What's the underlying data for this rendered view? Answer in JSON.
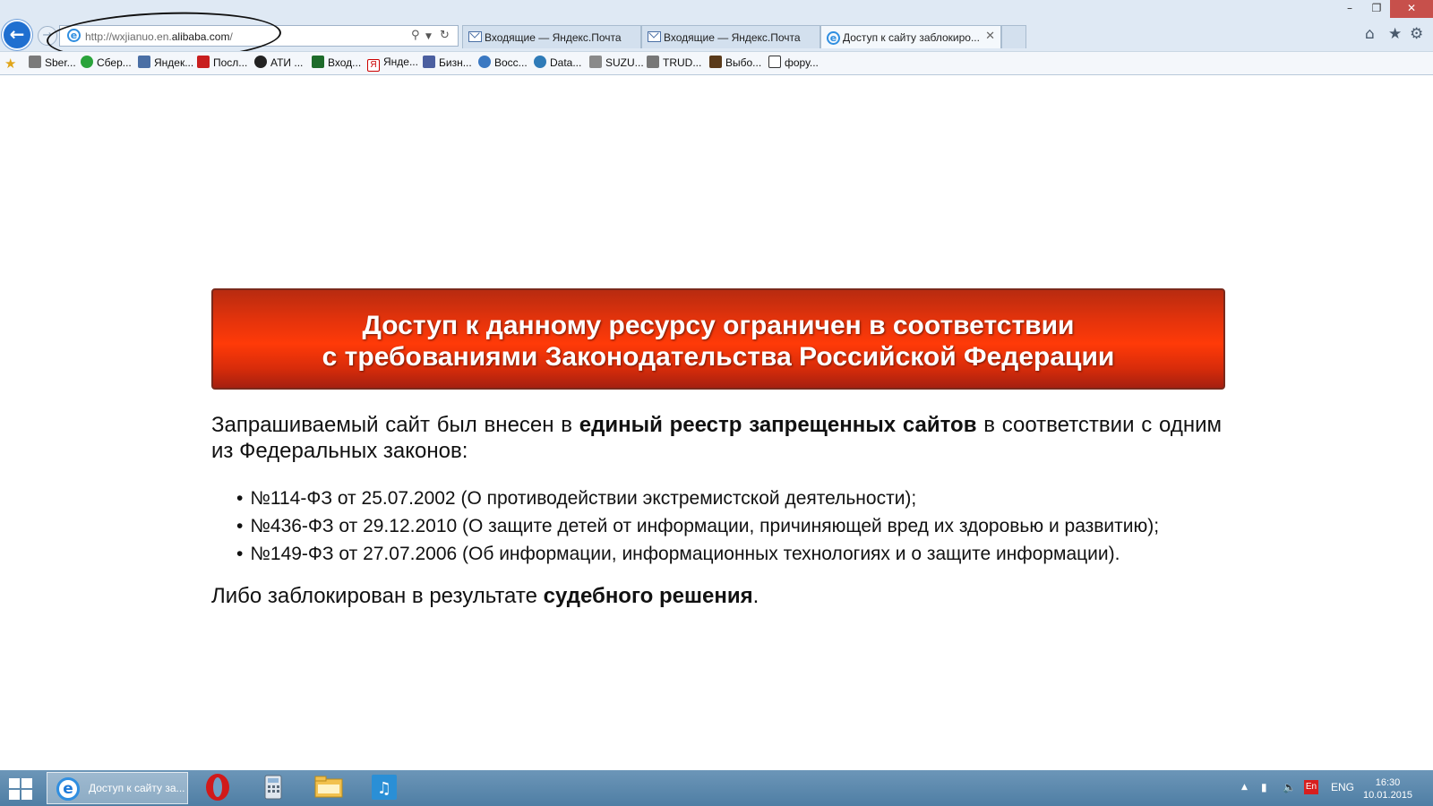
{
  "browser": {
    "address_url_prefix": "http://wxjianuo.en.",
    "address_url_domain": "alibaba.com",
    "address_url_suffix": "/",
    "tabs": [
      {
        "label": "Входящие — Яндекс.Почта",
        "active": false,
        "icon": "mail-icon"
      },
      {
        "label": "Входящие — Яндекс.Почта",
        "active": false,
        "icon": "mail-icon"
      },
      {
        "label": "Доступ к сайту заблокиро...",
        "active": true,
        "icon": "ie-icon"
      }
    ],
    "favorites": [
      "Sber...",
      "Сбер...",
      "Яндек...",
      "Посл...",
      "АТИ ...",
      "Вход...",
      "Янде...",
      "Бизн...",
      "Восс...",
      "Data...",
      "SUZU...",
      "TRUD...",
      "Выбо...",
      "фору..."
    ]
  },
  "page": {
    "banner_line1": "Доступ к данному ресурсу ограничен в соответствии",
    "banner_line2": "с требованиями Законодательства Российской Федерации",
    "lead_part1": "Запрашиваемый сайт был внесен в ",
    "lead_bold": "единый реестр запрещенных сайтов",
    "lead_part2": " в соответствии с одним из Федеральных законов:",
    "laws": [
      "№114-ФЗ от 25.07.2002 (О противодействии экстремистской деятельности);",
      "№436-ФЗ от 29.12.2010 (О защите детей от информации, причиняющей вред их здоровью и развитию);",
      "№149-ФЗ от 27.07.2006 (Об информации, информационных технологиях и о защите информации)."
    ],
    "tail_part1": "Либо заблокирован в результате ",
    "tail_bold": "судебного решения",
    "tail_part2": "."
  },
  "taskbar": {
    "active_window": "Доступ к сайту за...",
    "lang_badge": "En",
    "lang": "ENG",
    "time": "16:30",
    "date": "10.01.2015"
  },
  "colors": {
    "banner_red": "#e3330c",
    "chrome_blue": "#dfe9f4",
    "taskbar_blue": "#5a88ae"
  }
}
